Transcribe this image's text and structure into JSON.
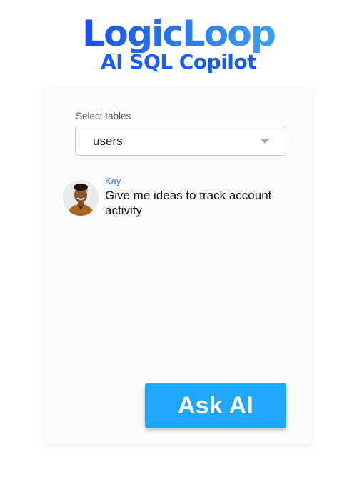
{
  "header": {
    "logo_text": "LogicLoop",
    "subtitle": "AI SQL Copilot",
    "brand_color": "#1a5cf0",
    "logo_gradient": [
      "#1a4fe6",
      "#3a9ff8"
    ]
  },
  "table_selector": {
    "label": "Select tables",
    "selected_value": "users",
    "icon": "caret-down-icon"
  },
  "chat": {
    "messages": [
      {
        "sender": "Kay",
        "text": "Give me ideas to track account activity",
        "avatar": "user-avatar"
      }
    ]
  },
  "actions": {
    "ask_label": "Ask AI",
    "ask_color": "#22a6fb"
  }
}
